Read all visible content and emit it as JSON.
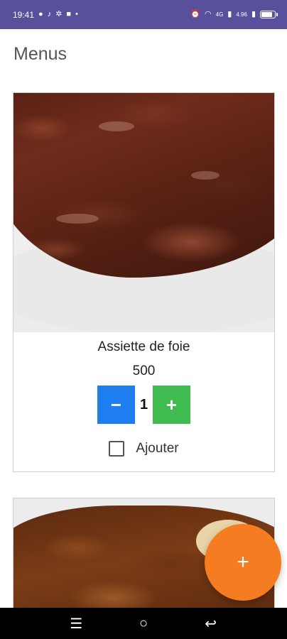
{
  "status_bar": {
    "time": "19:41",
    "left_icons": [
      "chat-bubble-icon",
      "tiktok-icon",
      "settings-icon",
      "app-icon",
      "dot-icon"
    ],
    "network_label": "4G",
    "speed_label": "4.96"
  },
  "page": {
    "title": "Menus"
  },
  "menu_items": [
    {
      "name": "Assiette de foie",
      "price": "500",
      "quantity": "1",
      "minus_label": "−",
      "plus_label": "+",
      "add_label": "Ajouter",
      "add_checked": false
    },
    {
      "name": "",
      "price": "",
      "quantity": ""
    }
  ],
  "fab": {
    "label": "+",
    "color": "#f57c21"
  },
  "nav_bar": {
    "menu_label": "☰",
    "home_label": "○",
    "back_label": "↩"
  },
  "colors": {
    "status_bar": "#58509a",
    "minus_button": "#1e7ef0",
    "plus_button": "#3fbb4f"
  }
}
